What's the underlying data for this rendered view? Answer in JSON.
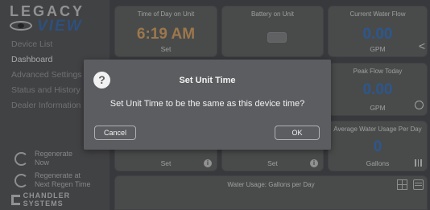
{
  "logo": {
    "top": "LEGACY",
    "bottom": "VIEW"
  },
  "nav": {
    "items": [
      {
        "label": "Device List"
      },
      {
        "label": "Dashboard"
      },
      {
        "label": "Advanced Settings"
      },
      {
        "label": "Status and History"
      },
      {
        "label": "Dealer Information"
      }
    ],
    "active_index": 1
  },
  "regen": {
    "now": {
      "line1": "Regenerate",
      "line2": "Now"
    },
    "next": {
      "line1": "Regenerate at",
      "line2": "Next Regen Time"
    }
  },
  "brand": {
    "text": "CHANDLER SYSTEMS"
  },
  "tiles": {
    "time_of_day": {
      "title": "Time of Day on Unit",
      "value": "6:19 AM",
      "unit": "Set"
    },
    "battery": {
      "title": "Battery on Unit"
    },
    "current_flow": {
      "title": "Current Water Flow",
      "value": "0.00",
      "unit": "GPM"
    },
    "peak_flow": {
      "title": "Peak Flow Today",
      "value": "0.00",
      "unit": "GPM"
    },
    "avg_usage": {
      "title": "Average Water Usage Per Day",
      "value": "0",
      "unit": "Gallons"
    },
    "set_a": {
      "unit": "Set"
    },
    "set_b": {
      "unit": "Set"
    },
    "usage_chart": {
      "title": "Water Usage: Gallons per Day"
    }
  },
  "dialog": {
    "title": "Set Unit Time",
    "message": "Set Unit Time to be the same as this device time?",
    "cancel_label": "Cancel",
    "ok_label": "OK",
    "help_glyph": "?"
  },
  "icons": {
    "info_glyph": "i",
    "chevron_glyph": "<"
  },
  "colors": {
    "value_orange": "#d9a56a",
    "value_blue": "#3e79c4",
    "background": "#4e5054"
  }
}
